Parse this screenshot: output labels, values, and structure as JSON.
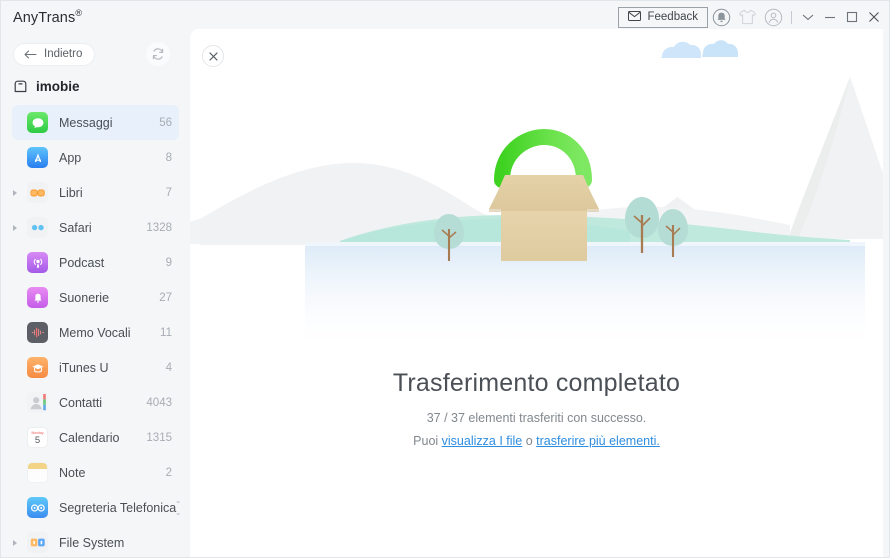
{
  "window": {
    "app_title": "AnyTrans",
    "registered_mark": "®"
  },
  "toolbar": {
    "feedback_label": "Feedback",
    "feedback_icon": "envelope-icon",
    "bell_icon": "bell-icon",
    "shirt_icon": "t-shirt-icon",
    "account_icon": "user-account-icon",
    "chevron_icon": "chevron-down-icon",
    "minimize_icon": "minimize-icon",
    "maximize_icon": "maximize-icon",
    "close_icon": "close-icon"
  },
  "sidebar": {
    "back_label": "Indietro",
    "back_icon": "arrow-left-icon",
    "refresh_icon": "refresh-icon",
    "device_name": "imobie",
    "device_icon": "device-icon",
    "items": [
      {
        "label": "Messaggi",
        "count": "56",
        "icon": "messages-icon",
        "selected": true,
        "expandable": false
      },
      {
        "label": "App",
        "count": "8",
        "icon": "appstore-icon",
        "selected": false,
        "expandable": false
      },
      {
        "label": "Libri",
        "count": "7",
        "icon": "books-icon",
        "selected": false,
        "expandable": true
      },
      {
        "label": "Safari",
        "count": "1328",
        "icon": "safari-icon",
        "selected": false,
        "expandable": true
      },
      {
        "label": "Podcast",
        "count": "9",
        "icon": "podcast-icon",
        "selected": false,
        "expandable": false
      },
      {
        "label": "Suonerie",
        "count": "27",
        "icon": "ringtones-icon",
        "selected": false,
        "expandable": false
      },
      {
        "label": "Memo Vocali",
        "count": "11",
        "icon": "voicememo-icon",
        "selected": false,
        "expandable": false
      },
      {
        "label": "iTunes U",
        "count": "4",
        "icon": "itunesu-icon",
        "selected": false,
        "expandable": false
      },
      {
        "label": "Contatti",
        "count": "4043",
        "icon": "contacts-icon",
        "selected": false,
        "expandable": false
      },
      {
        "label": "Calendario",
        "count": "1315",
        "icon": "calendar-icon",
        "selected": false,
        "expandable": false
      },
      {
        "label": "Note",
        "count": "2",
        "icon": "notes-icon",
        "selected": false,
        "expandable": false
      },
      {
        "label": "Segreteria Telefonica",
        "count": "--",
        "icon": "voicemail-icon",
        "selected": false,
        "expandable": false
      },
      {
        "label": "File System",
        "count": "",
        "icon": "filesystem-icon",
        "selected": false,
        "expandable": true
      }
    ]
  },
  "content": {
    "close_icon": "close-icon",
    "title": "Trasferimento completato",
    "subtitle": "37 / 37 elementi trasferiti con successo.",
    "links_prefix": "Puoi ",
    "link_view": "visualizza I file",
    "links_middle": " o ",
    "link_transfer": "trasferire più elementi.",
    "illustration": "transfer-complete-illustration"
  },
  "colors": {
    "accent_link": "#2e8de0",
    "selected_row": "#e8f1fb",
    "sidebar_bg": "#f4f6f8",
    "panel_bg": "#ffffff",
    "box_tan": "#e3cda0",
    "handle_green": "#53dd2f",
    "hill_mint": "#b9e8dd",
    "water_blue": "#e3eef9"
  }
}
